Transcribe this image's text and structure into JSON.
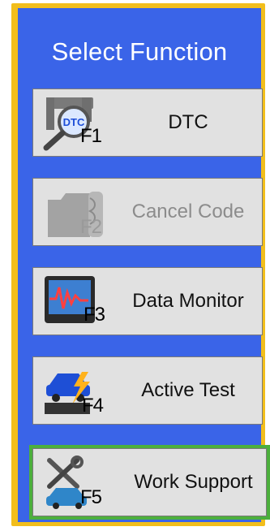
{
  "title": "Select Function",
  "buttons": [
    {
      "label": "DTC",
      "fkey": "F1",
      "icon": "dtc-magnifier-icon",
      "enabled": true
    },
    {
      "label": "Cancel Code",
      "fkey": "F2",
      "icon": "cancel-code-icon",
      "enabled": false
    },
    {
      "label": "Data Monitor",
      "fkey": "F3",
      "icon": "data-monitor-icon",
      "enabled": true
    },
    {
      "label": "Active Test",
      "fkey": "F4",
      "icon": "active-test-icon",
      "enabled": true
    },
    {
      "label": "Work Support",
      "fkey": "F5",
      "icon": "work-support-icon",
      "enabled": true
    }
  ],
  "colors": {
    "panel": "#3a64e8",
    "frame": "#f2be1c",
    "selected": "#4caf3d",
    "button": "#e1e1e1"
  }
}
